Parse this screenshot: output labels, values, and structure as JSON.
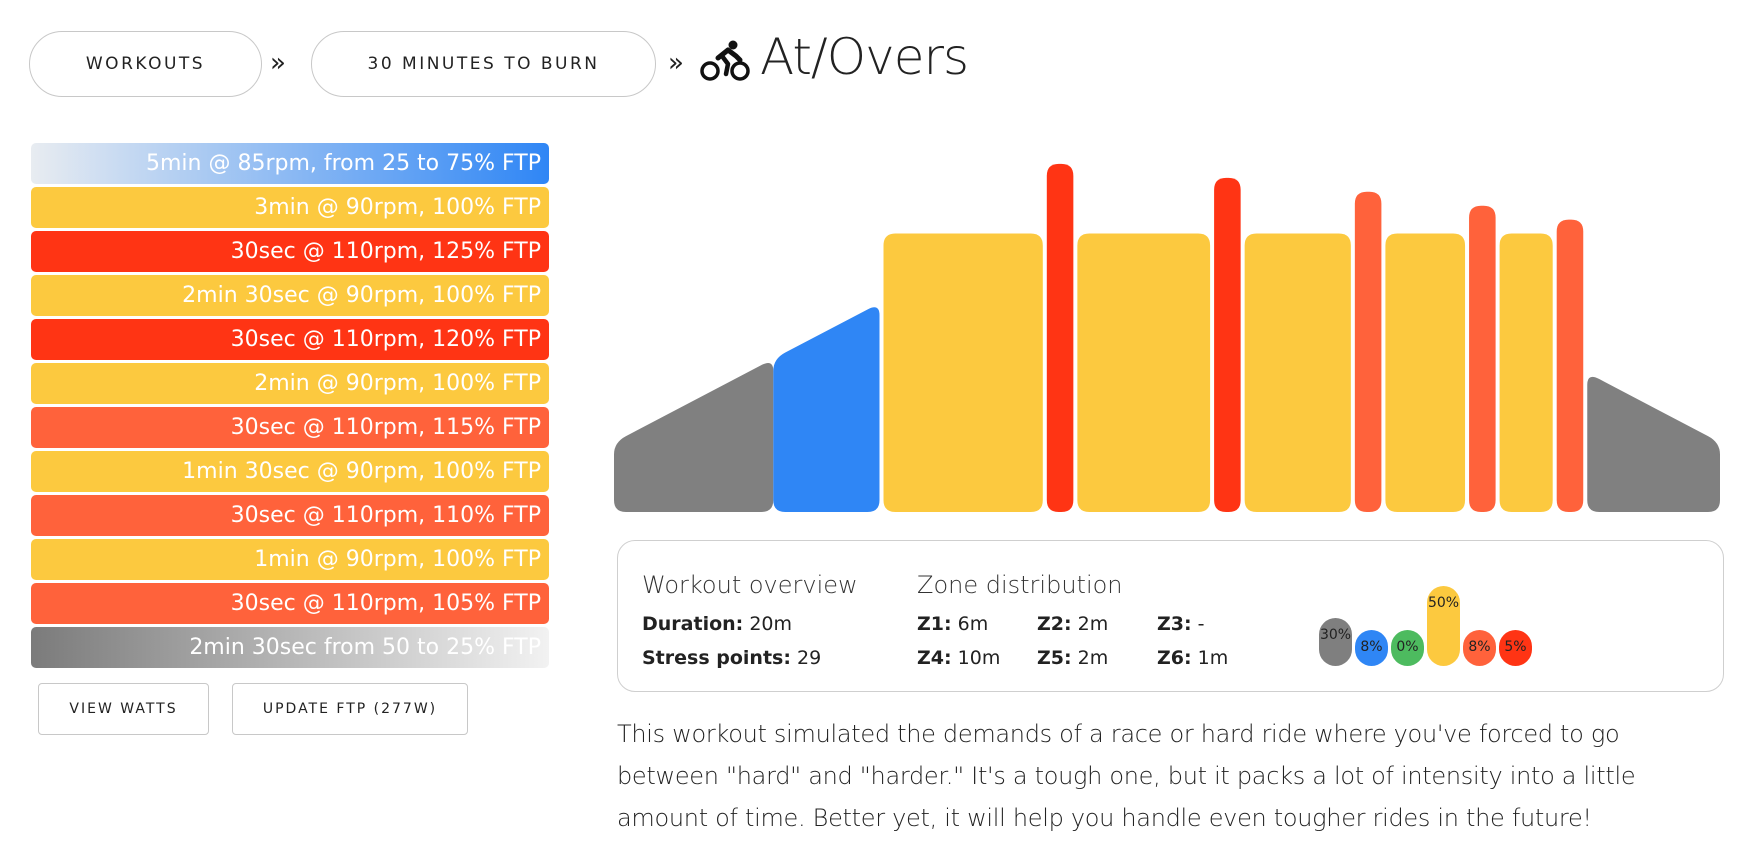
{
  "breadcrumb": {
    "items": [
      "WORKOUTS",
      "30 MINUTES TO BURN"
    ],
    "separator": "»",
    "title": "At/Overs"
  },
  "intervals": [
    {
      "label": "5min @ 85rpm, from 25 to 75% FTP",
      "kind": "ramp-up",
      "colors": [
        "#e8ecf1",
        "#2f86f5"
      ]
    },
    {
      "label": "3min @ 90rpm, 100% FTP",
      "kind": "solid",
      "color": "#fcc93f"
    },
    {
      "label": "30sec @ 110rpm, 125% FTP",
      "kind": "solid",
      "color": "#ff3414"
    },
    {
      "label": "2min 30sec @ 90rpm, 100% FTP",
      "kind": "solid",
      "color": "#fcc93f"
    },
    {
      "label": "30sec @ 110rpm, 120% FTP",
      "kind": "solid",
      "color": "#ff3414"
    },
    {
      "label": "2min @ 90rpm, 100% FTP",
      "kind": "solid",
      "color": "#fcc93f"
    },
    {
      "label": "30sec @ 110rpm, 115% FTP",
      "kind": "solid",
      "color": "#ff623b"
    },
    {
      "label": "1min 30sec @ 90rpm, 100% FTP",
      "kind": "solid",
      "color": "#fcc93f"
    },
    {
      "label": "30sec @ 110rpm, 110% FTP",
      "kind": "solid",
      "color": "#ff623b"
    },
    {
      "label": "1min @ 90rpm, 100% FTP",
      "kind": "solid",
      "color": "#fcc93f"
    },
    {
      "label": "30sec @ 110rpm, 105% FTP",
      "kind": "solid",
      "color": "#ff623b"
    },
    {
      "label": "2min 30sec from 50 to 25% FTP",
      "kind": "ramp-down",
      "colors": [
        "#7b7b7b",
        "#f2f2f2"
      ]
    }
  ],
  "buttons": {
    "view_watts": "VIEW WATTS",
    "update_ftp": "UPDATE FTP (277W)"
  },
  "overview": {
    "heading": "Workout overview",
    "duration_label": "Duration:",
    "duration_value": "20m",
    "stress_label": "Stress points:",
    "stress_value": "29"
  },
  "zones": {
    "heading": "Zone distribution",
    "items": [
      {
        "label": "Z1:",
        "value": "6m"
      },
      {
        "label": "Z2:",
        "value": "2m"
      },
      {
        "label": "Z3:",
        "value": "-"
      },
      {
        "label": "Z4:",
        "value": "10m"
      },
      {
        "label": "Z5:",
        "value": "2m"
      },
      {
        "label": "Z6:",
        "value": "1m"
      }
    ],
    "distribution": [
      {
        "pct": "30%",
        "value": 30,
        "color": "#7f7f7f"
      },
      {
        "pct": "8%",
        "value": 8,
        "color": "#2f86f5"
      },
      {
        "pct": "0%",
        "value": 0,
        "color": "#4dbb5f"
      },
      {
        "pct": "50%",
        "value": 50,
        "color": "#fcc93f"
      },
      {
        "pct": "8%",
        "value": 8,
        "color": "#ff623b"
      },
      {
        "pct": "5%",
        "value": 5,
        "color": "#ff3414"
      }
    ]
  },
  "description": "This workout simulated the demands of a race or hard ride where you've forced to go between \"hard\" and \"harder.\" It's a tough one, but it packs a lot of intensity into a little amount of time. Better yet, it will help you handle even tougher rides in the future!",
  "profile": {
    "unit": "% FTP",
    "segments": [
      {
        "duration_sec": 180,
        "from": 25,
        "to": 55,
        "color": "#808080"
      },
      {
        "duration_sec": 120,
        "from": 55,
        "to": 75,
        "color": "#2f86f5"
      },
      {
        "duration_sec": 180,
        "from": 100,
        "to": 100,
        "color": "#fcc93f"
      },
      {
        "duration_sec": 30,
        "from": 125,
        "to": 125,
        "color": "#ff3414"
      },
      {
        "duration_sec": 150,
        "from": 100,
        "to": 100,
        "color": "#fcc93f"
      },
      {
        "duration_sec": 30,
        "from": 120,
        "to": 120,
        "color": "#ff3414"
      },
      {
        "duration_sec": 120,
        "from": 100,
        "to": 100,
        "color": "#fcc93f"
      },
      {
        "duration_sec": 30,
        "from": 115,
        "to": 115,
        "color": "#ff623b"
      },
      {
        "duration_sec": 90,
        "from": 100,
        "to": 100,
        "color": "#fcc93f"
      },
      {
        "duration_sec": 30,
        "from": 110,
        "to": 110,
        "color": "#ff623b"
      },
      {
        "duration_sec": 60,
        "from": 100,
        "to": 100,
        "color": "#fcc93f"
      },
      {
        "duration_sec": 30,
        "from": 105,
        "to": 105,
        "color": "#ff623b"
      },
      {
        "duration_sec": 150,
        "from": 50,
        "to": 25,
        "color": "#808080"
      }
    ]
  }
}
